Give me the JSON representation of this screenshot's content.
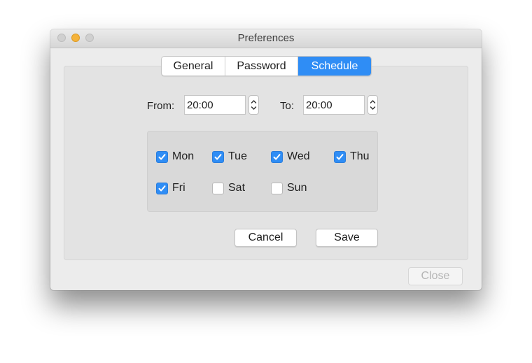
{
  "window": {
    "title": "Preferences"
  },
  "tabs": [
    {
      "label": "General",
      "active": false
    },
    {
      "label": "Password",
      "active": false
    },
    {
      "label": "Schedule",
      "active": true
    }
  ],
  "schedule": {
    "from_label": "From:",
    "from_value": "20:00",
    "to_label": "To:",
    "to_value": "20:00",
    "days": [
      {
        "label": "Mon",
        "checked": true
      },
      {
        "label": "Tue",
        "checked": true
      },
      {
        "label": "Wed",
        "checked": true
      },
      {
        "label": "Thu",
        "checked": true
      },
      {
        "label": "Fri",
        "checked": true
      },
      {
        "label": "Sat",
        "checked": false
      },
      {
        "label": "Sun",
        "checked": false
      }
    ]
  },
  "buttons": {
    "cancel": "Cancel",
    "save": "Save",
    "close": "Close"
  },
  "colors": {
    "accent": "#2f8df5",
    "window_bg": "#ececec",
    "group_bg": "#d9d9d9"
  },
  "icons": {
    "check": "checkmark-icon",
    "stepper": "stepper-arrows-icon"
  }
}
